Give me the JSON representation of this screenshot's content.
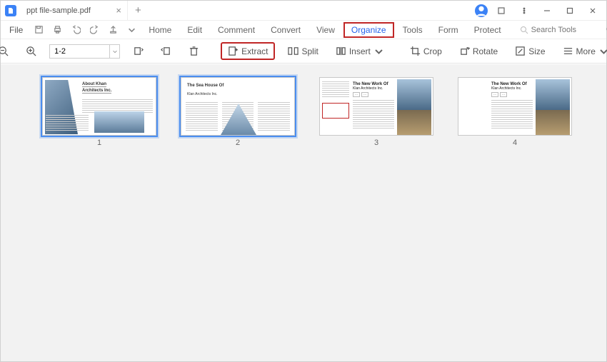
{
  "window": {
    "tab_title": "ppt file-sample.pdf"
  },
  "menubar": {
    "file": "File",
    "items": [
      "Home",
      "Edit",
      "Comment",
      "Convert",
      "View",
      "Organize",
      "Tools",
      "Form",
      "Protect"
    ],
    "active_index": 5,
    "search_placeholder": "Search Tools"
  },
  "toolbar": {
    "page_range_value": "1-2",
    "extract": "Extract",
    "split": "Split",
    "insert": "Insert",
    "crop": "Crop",
    "rotate": "Rotate",
    "size": "Size",
    "more": "More"
  },
  "thumbs": {
    "selected": [
      1,
      2
    ],
    "pages": [
      {
        "num": "1",
        "title": "About Khan",
        "subtitle": "Architects Inc."
      },
      {
        "num": "2",
        "title": "The Sea House Of",
        "subtitle": "Klan Architects Inc."
      },
      {
        "num": "3",
        "title": "The New Work Of",
        "subtitle": "Klan Architects Inc."
      },
      {
        "num": "4",
        "title": "The New Work Of",
        "subtitle": "Klan Architects Inc."
      }
    ]
  }
}
